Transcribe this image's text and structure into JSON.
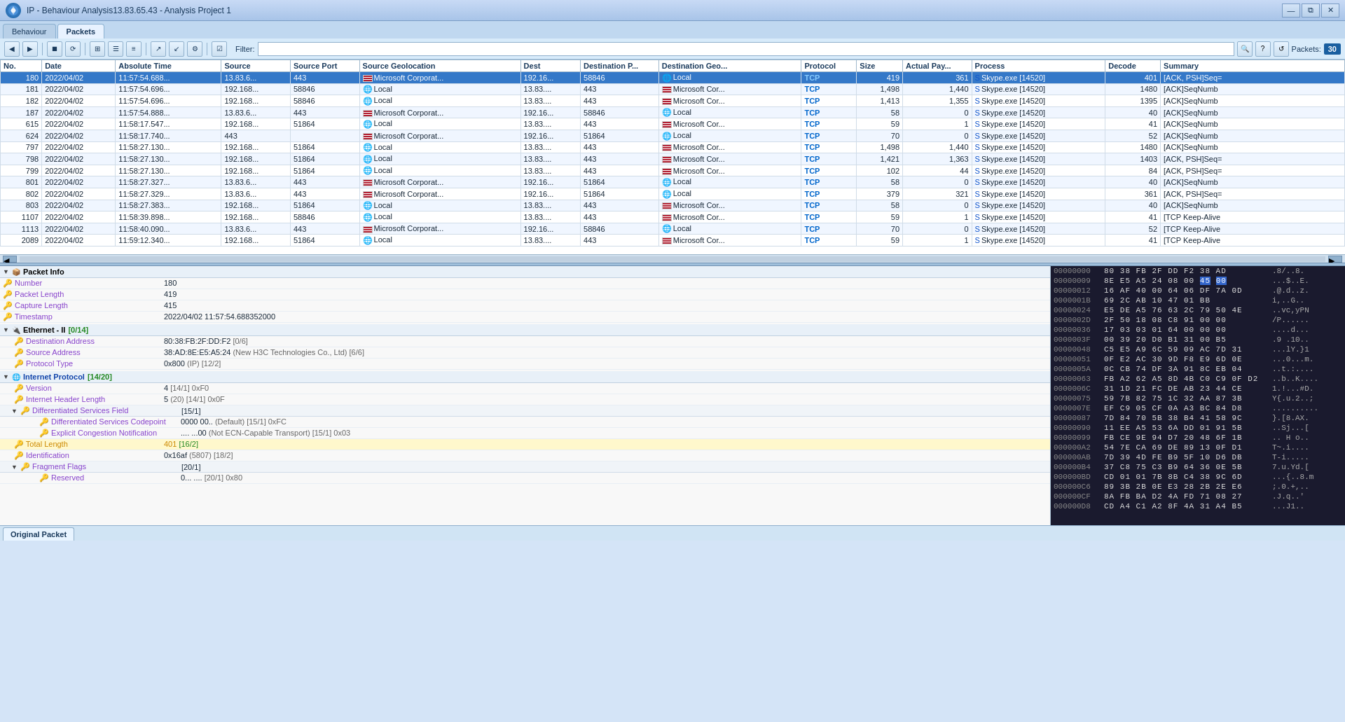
{
  "window": {
    "title": "IP - Behaviour Analysis13.83.65.43 - Analysis Project 1",
    "controls": [
      "minimize",
      "restore",
      "close"
    ]
  },
  "tabs": [
    {
      "label": "Behaviour",
      "active": false
    },
    {
      "label": "Packets",
      "active": true
    }
  ],
  "toolbar": {
    "filter_label": "Filter:",
    "filter_placeholder": "",
    "packets_label": "Packets:",
    "packets_count": "30"
  },
  "table": {
    "columns": [
      "No.",
      "Date",
      "Absolute Time",
      "Source",
      "Source Port",
      "Source Geolocation",
      "Dest",
      "Destination P...",
      "Destination Geo...",
      "Protocol",
      "Size",
      "Actual Pay...",
      "Process",
      "Decode",
      "Summary"
    ],
    "rows": [
      {
        "no": "180",
        "date": "2022/04/02",
        "abstime": "11:57:54.688...",
        "src": "13.83.6...",
        "srcport": "443",
        "srcgeo": "🇺🇸 Microsoft Corporat...",
        "dest": "192.16...",
        "destport": "58846",
        "destgeo": "🌐 Local",
        "proto": "TCP",
        "size": "419",
        "actual": "361",
        "process": "Skype.exe [14520]",
        "decode": "401",
        "summary": "[ACK, PSH]Seq="
      },
      {
        "no": "181",
        "date": "2022/04/02",
        "abstime": "11:57:54.696...",
        "src": "192.168...",
        "srcport": "58846",
        "srcgeo": "🌐 Local",
        "dest": "13.83....",
        "destport": "443",
        "destgeo": "🇺🇸 Microsoft Cor...",
        "proto": "TCP",
        "size": "1,498",
        "actual": "1,440",
        "process": "Skype.exe [14520]",
        "decode": "1480",
        "summary": "[ACK]SeqNumb"
      },
      {
        "no": "182",
        "date": "2022/04/02",
        "abstime": "11:57:54.696...",
        "src": "192.168...",
        "srcport": "58846",
        "srcgeo": "🌐 Local",
        "dest": "13.83....",
        "destport": "443",
        "destgeo": "🇺🇸 Microsoft Cor...",
        "proto": "TCP",
        "size": "1,413",
        "actual": "1,355",
        "process": "Skype.exe [14520]",
        "decode": "1395",
        "summary": "[ACK]SeqNumb"
      },
      {
        "no": "187",
        "date": "2022/04/02",
        "abstime": "11:57:54.888...",
        "src": "13.83.6...",
        "srcport": "443",
        "srcgeo": "🇺🇸 Microsoft Corporat...",
        "dest": "192.16...",
        "destport": "58846",
        "destgeo": "🌐 Local",
        "proto": "TCP",
        "size": "58",
        "actual": "0",
        "process": "Skype.exe [14520]",
        "decode": "40",
        "summary": "[ACK]SeqNumb"
      },
      {
        "no": "615",
        "date": "2022/04/02",
        "abstime": "11:58:17.547...",
        "src": "192.168...",
        "srcport": "51864",
        "srcgeo": "🌐 Local",
        "dest": "13.83....",
        "destport": "443",
        "destgeo": "🇺🇸 Microsoft Cor...",
        "proto": "TCP",
        "size": "59",
        "actual": "1",
        "process": "Skype.exe [14520]",
        "decode": "41",
        "summary": "[ACK]SeqNumb"
      },
      {
        "no": "624",
        "date": "2022/04/02",
        "abstime": "11:58:17.740...",
        "src": "443",
        "srcport": "",
        "srcgeo": "🇺🇸 Microsoft Corporat...",
        "dest": "192.16...",
        "destport": "51864",
        "destgeo": "🌐 Local",
        "proto": "TCP",
        "size": "70",
        "actual": "0",
        "process": "Skype.exe [14520]",
        "decode": "52",
        "summary": "[ACK]SeqNumb"
      },
      {
        "no": "797",
        "date": "2022/04/02",
        "abstime": "11:58:27.130...",
        "src": "192.168...",
        "srcport": "51864",
        "srcgeo": "🌐 Local",
        "dest": "13.83....",
        "destport": "443",
        "destgeo": "🇺🇸 Microsoft Cor...",
        "proto": "TCP",
        "size": "1,498",
        "actual": "1,440",
        "process": "Skype.exe [14520]",
        "decode": "1480",
        "summary": "[ACK]SeqNumb"
      },
      {
        "no": "798",
        "date": "2022/04/02",
        "abstime": "11:58:27.130...",
        "src": "192.168...",
        "srcport": "51864",
        "srcgeo": "🌐 Local",
        "dest": "13.83....",
        "destport": "443",
        "destgeo": "🇺🇸 Microsoft Cor...",
        "proto": "TCP",
        "size": "1,421",
        "actual": "1,363",
        "process": "Skype.exe [14520]",
        "decode": "1403",
        "summary": "[ACK, PSH]Seq="
      },
      {
        "no": "799",
        "date": "2022/04/02",
        "abstime": "11:58:27.130...",
        "src": "192.168...",
        "srcport": "51864",
        "srcgeo": "🌐 Local",
        "dest": "13.83....",
        "destport": "443",
        "destgeo": "🇺🇸 Microsoft Cor...",
        "proto": "TCP",
        "size": "102",
        "actual": "44",
        "process": "Skype.exe [14520]",
        "decode": "84",
        "summary": "[ACK, PSH]Seq="
      },
      {
        "no": "801",
        "date": "2022/04/02",
        "abstime": "11:58:27.327...",
        "src": "13.83.6...",
        "srcport": "443",
        "srcgeo": "🇺🇸 Microsoft Corporat...",
        "dest": "192.16...",
        "destport": "51864",
        "destgeo": "🌐 Local",
        "proto": "TCP",
        "size": "58",
        "actual": "0",
        "process": "Skype.exe [14520]",
        "decode": "40",
        "summary": "[ACK]SeqNumb"
      },
      {
        "no": "802",
        "date": "2022/04/02",
        "abstime": "11:58:27.329...",
        "src": "13.83.6...",
        "srcport": "443",
        "srcgeo": "🇺🇸 Microsoft Corporat...",
        "dest": "192.16...",
        "destport": "51864",
        "destgeo": "🌐 Local",
        "proto": "TCP",
        "size": "379",
        "actual": "321",
        "process": "Skype.exe [14520]",
        "decode": "361",
        "summary": "[ACK, PSH]Seq="
      },
      {
        "no": "803",
        "date": "2022/04/02",
        "abstime": "11:58:27.383...",
        "src": "192.168...",
        "srcport": "51864",
        "srcgeo": "🌐 Local",
        "dest": "13.83....",
        "destport": "443",
        "destgeo": "🇺🇸 Microsoft Cor...",
        "proto": "TCP",
        "size": "58",
        "actual": "0",
        "process": "Skype.exe [14520]",
        "decode": "40",
        "summary": "[ACK]SeqNumb"
      },
      {
        "no": "1107",
        "date": "2022/04/02",
        "abstime": "11:58:39.898...",
        "src": "192.168...",
        "srcport": "58846",
        "srcgeo": "🌐 Local",
        "dest": "13.83....",
        "destport": "443",
        "destgeo": "🇺🇸 Microsoft Cor...",
        "proto": "TCP",
        "size": "59",
        "actual": "1",
        "process": "Skype.exe [14520]",
        "decode": "41",
        "summary": "[TCP Keep-Alive"
      },
      {
        "no": "1113",
        "date": "2022/04/02",
        "abstime": "11:58:40.090...",
        "src": "13.83.6...",
        "srcport": "443",
        "srcgeo": "🇺🇸 Microsoft Corporat...",
        "dest": "192.16...",
        "destport": "58846",
        "destgeo": "🌐 Local",
        "proto": "TCP",
        "size": "70",
        "actual": "0",
        "process": "Skype.exe [14520]",
        "decode": "52",
        "summary": "[TCP Keep-Alive"
      },
      {
        "no": "2089",
        "date": "2022/04/02",
        "abstime": "11:59:12.340...",
        "src": "192.168...",
        "srcport": "51864",
        "srcgeo": "🌐 Local",
        "dest": "13.83....",
        "destport": "443",
        "destgeo": "🇺🇸 Microsoft Cor...",
        "proto": "TCP",
        "size": "59",
        "actual": "1",
        "process": "Skype.exe [14520]",
        "decode": "41",
        "summary": "[TCP Keep-Alive"
      }
    ]
  },
  "detail": {
    "sections": [
      {
        "id": "packet-info",
        "label": "Packet Info",
        "expanded": true,
        "fields": [
          {
            "key": "Number",
            "value": "180"
          },
          {
            "key": "Packet Length",
            "value": "419"
          },
          {
            "key": "Capture Length",
            "value": "415"
          },
          {
            "key": "Timestamp",
            "value": "2022/04/02 11:57:54.688352000"
          }
        ]
      },
      {
        "id": "ethernet",
        "label": "Ethernet - II",
        "bracket": "[0/14]",
        "expanded": true,
        "fields": [
          {
            "key": "Destination Address",
            "value": "80:38:FB:2F:DD:F2",
            "annotation": " [0/6]"
          },
          {
            "key": "Source Address",
            "value": "38:AD:8E:E5:A5:24",
            "annotation": " (New H3C Technologies Co., Ltd) [6/6]"
          },
          {
            "key": "Protocol Type",
            "value": "0x800",
            "annotation": " (IP) [12/2]"
          }
        ]
      },
      {
        "id": "internet-protocol",
        "label": "Internet Protocol",
        "bracket": "[14/20]",
        "expanded": true,
        "fields": [
          {
            "key": "Version",
            "value": "4",
            "annotation": " [14/1] 0xF0"
          },
          {
            "key": "Internet Header Length",
            "value": "5",
            "annotation": " (20) [14/1] 0x0F"
          },
          {
            "key": "Differentiated Services Field",
            "value": "",
            "annotation": "[15/1]",
            "subsection": true
          },
          {
            "key": "Differentiated Services Codepoint",
            "value": "0000 00..",
            "annotation": " (Default) [15/1] 0xFC",
            "indent": true
          },
          {
            "key": "Explicit Congestion Notification",
            "value": ".... ...00",
            "annotation": " (Not ECN-Capable Transport) [15/1] 0x03",
            "indent": true
          },
          {
            "key": "Total Length",
            "value": "401",
            "annotation": " [16/2]",
            "highlight": true
          },
          {
            "key": "Identification",
            "value": "0x16af",
            "annotation": " (5807) [18/2]"
          },
          {
            "key": "Fragment Flags",
            "value": "",
            "annotation": "[20/1]",
            "subsection": true
          },
          {
            "key": "Reserved",
            "value": "0... ....",
            "annotation": " [20/1] 0x80",
            "indent": true
          }
        ]
      }
    ]
  },
  "hex": {
    "rows": [
      {
        "addr": "00000000",
        "bytes": "80 38 FB 2F DD F2 38 AD",
        "ascii": ".8/..8."
      },
      {
        "addr": "00000009",
        "bytes": "8E E5 A5 24 08 00 45 00",
        "ascii": "...$..E.",
        "highlight_range": [
          7,
          7
        ]
      },
      {
        "addr": "00000012",
        "bytes": "16 AF 40 00 64 06 DF 7A 0D",
        "ascii": ".@.d..z."
      },
      {
        "addr": "0000001B",
        "bytes": "69 2C AB 10 47 01 BB",
        "ascii": "i,..G.."
      },
      {
        "addr": "00000024",
        "bytes": "E5 DE A5 76 63 2C 79 50 4E",
        "ascii": "..vc,yPN"
      },
      {
        "addr": "0000002D",
        "bytes": "2F 50 18 08 C8 91 00 00",
        "ascii": "/P......"
      },
      {
        "addr": "00000036",
        "bytes": "17 03 03 01 64 00 00 00",
        "ascii": "....d..."
      },
      {
        "addr": "0000003F",
        "bytes": "00 39 20 D0 B1 31 00 B5",
        "ascii": ".9 .10.."
      },
      {
        "addr": "00000048",
        "bytes": "C5 E5 A9 6C 59 09 AC 7D 31",
        "ascii": "...lY.}1"
      },
      {
        "addr": "00000051",
        "bytes": "0F E2 AC 30 9D F8 E9 6D 0E",
        "ascii": "...0...m."
      },
      {
        "addr": "0000005A",
        "bytes": "0C CB 74 DF 3A 91 8C EB 04",
        "ascii": "..t.:...."
      },
      {
        "addr": "00000063",
        "bytes": "FB A2 62 A5 8D 4B C0 C9 0F D2",
        "ascii": "..b..K...."
      },
      {
        "addr": "0000006C",
        "bytes": "31 1D 21 FC DE AB 23 44 CE",
        "ascii": "1.!...#D."
      },
      {
        "addr": "00000075",
        "bytes": "59 7B 82 75 1C 32 AA 87 3B",
        "ascii": "Y{.u.2..;"
      },
      {
        "addr": "0000007E",
        "bytes": "EF C9 05 CF 0A A3 BC 84 D8",
        "ascii": ".........."
      },
      {
        "addr": "00000087",
        "bytes": "7D 84 70 5B 38 B4 41 58 9C",
        "ascii": "}.[8.AX."
      },
      {
        "addr": "00000090",
        "bytes": "11 EE A5 53 6A DD 01 91 5B",
        "ascii": "..Sj...["
      },
      {
        "addr": "00000099",
        "bytes": "FB CE 9E 94 D7 20 48 6F 1B",
        "ascii": ".. H o.."
      },
      {
        "addr": "000000A2",
        "bytes": "54 7E CA 69 DE 89 13 0F D1",
        "ascii": "T~.i...."
      },
      {
        "addr": "000000AB",
        "bytes": "7D 39 4D FE B9 5F 10 D6 DB",
        "ascii": "T-i....."
      },
      {
        "addr": "000000B4",
        "bytes": "37 C8 75 C3 B9 64 36 0E 5B",
        "ascii": "7.u.Yd.["
      },
      {
        "addr": "000000BD",
        "bytes": "CD 01 01 7B 8B C4 38 9C 6D",
        "ascii": "...{..8.m"
      },
      {
        "addr": "000000C6",
        "bytes": "89 3B 2B 0E E3 28 2B 2E E6",
        "ascii": ";.0.+,.."
      },
      {
        "addr": "000000CF",
        "bytes": "8A FB BA D2 4A FD 71 08 27",
        "ascii": ".J.q..'"
      },
      {
        "addr": "000000D8",
        "bytes": "CD A4 C1 A2 8F 4A 31 A4 B5",
        "ascii": "...J1.."
      }
    ]
  },
  "bottom_tab": {
    "label": "Original Packet",
    "active": true
  }
}
